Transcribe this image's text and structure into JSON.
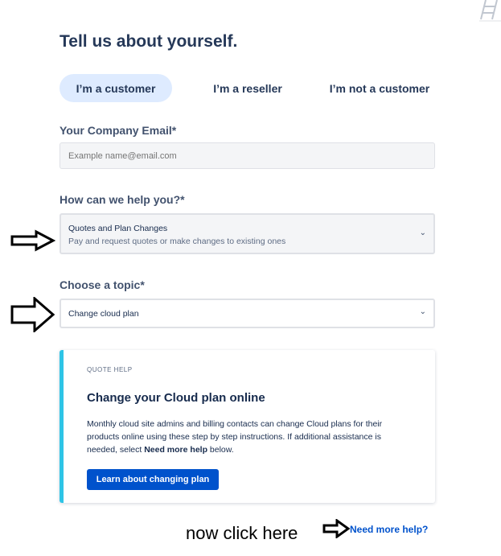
{
  "page": {
    "title": "Tell us about yourself."
  },
  "tabs": [
    {
      "label": "I’m a customer",
      "active": true
    },
    {
      "label": "I’m a reseller",
      "active": false
    },
    {
      "label": "I’m not a customer",
      "active": false
    }
  ],
  "email": {
    "label": "Your Company Email*",
    "placeholder": "Example name@email.com",
    "value": ""
  },
  "help": {
    "label": "How can we help you?*",
    "selected_title": "Quotes and Plan Changes",
    "selected_subtitle": "Pay and request quotes or make changes to existing ones"
  },
  "topic": {
    "label": "Choose a topic*",
    "selected": "Change cloud plan"
  },
  "card": {
    "eyebrow": "QUOTE HELP",
    "title": "Change your Cloud plan online",
    "body_line1": "Monthly cloud site admins and billing contacts can change Cloud plans for their",
    "body_line2": "products online using these step by step instructions. If additional assistance is",
    "body_line3_pre": "needed, select ",
    "body_line3_bold": "Need more help",
    "body_line3_post": " below.",
    "button_label": "Learn about changing plan",
    "accent_color": "#2ec4e6"
  },
  "footer": {
    "need_more_help": "Need more help?"
  },
  "annotation": {
    "text": "now click here"
  },
  "icons": {
    "chevron": "chevron-down-icon",
    "arrow": "arrow-right-icon"
  }
}
